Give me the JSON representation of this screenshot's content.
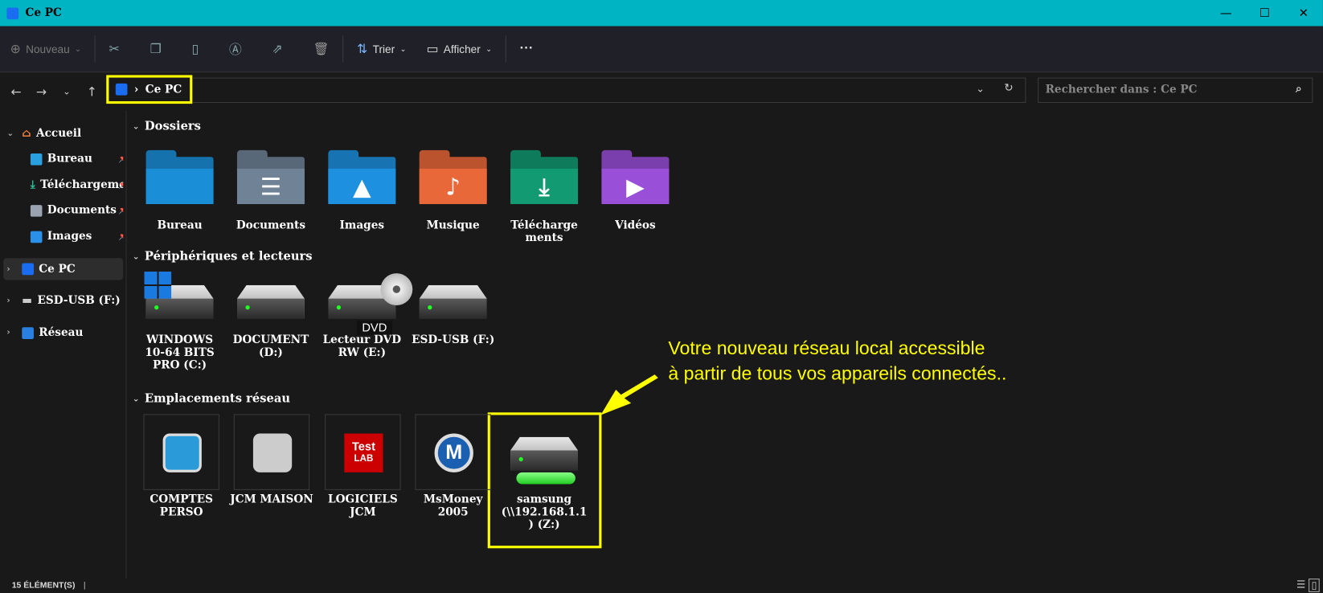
{
  "window": {
    "title": "Ce PC",
    "minimize": "—",
    "maximize": "☐",
    "close": "✕"
  },
  "toolbar": {
    "new": "Nouveau",
    "sort": "Trier",
    "view": "Afficher",
    "more": "···"
  },
  "address": {
    "crumb": "Ce PC",
    "search_placeholder": "Rechercher dans : Ce PC"
  },
  "sidebar": {
    "home": "Accueil",
    "pinned": [
      "Bureau",
      "Téléchargements",
      "Documents",
      "Images"
    ],
    "thispc": "Ce PC",
    "usb": "ESD-USB (F:)",
    "network": "Réseau"
  },
  "sections": {
    "folders": "Dossiers",
    "devices": "Périphériques et lecteurs",
    "network": "Emplacements réseau"
  },
  "folders": [
    {
      "label": "Bureau",
      "color": "#1a8fd8"
    },
    {
      "label": "Documents",
      "color": "#6f8296"
    },
    {
      "label": "Images",
      "color": "#1e90e0"
    },
    {
      "label": "Musique",
      "color": "#e8683a"
    },
    {
      "label": "Télécharge ments",
      "color": "#129a72"
    },
    {
      "label": "Vidéos",
      "color": "#9a4fd8"
    }
  ],
  "drives": [
    {
      "label": "WINDOWS 10-64 BITS PRO (C:)"
    },
    {
      "label": "DOCUMENT (D:)"
    },
    {
      "label": "Lecteur DVD RW (E:)",
      "badge": "DVD"
    },
    {
      "label": "ESD-USB (F:)"
    }
  ],
  "network": [
    {
      "label": "COMPTES PERSO"
    },
    {
      "label": "JCM MAISON"
    },
    {
      "label": "LOGICIELS JCM",
      "badge_top": "Test",
      "badge_bottom": "LAB"
    },
    {
      "label": "MsMoney 2005",
      "badge": "M"
    },
    {
      "label": "samsung (\\\\192.168.1.1 ) (Z:)"
    }
  ],
  "callout": {
    "line1": "Votre nouveau réseau local accessible",
    "line2": "à partir de tous vos appareils connectés.."
  },
  "status": {
    "count": "15 élément(s)"
  }
}
